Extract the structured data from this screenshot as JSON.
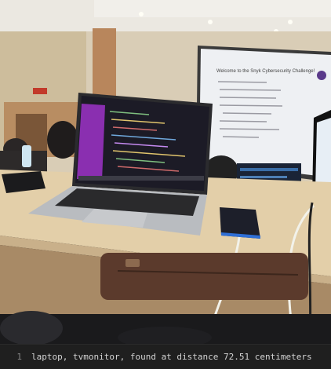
{
  "photo": {
    "subject": "laptop-on-desk-in-lecture-hall",
    "colors": {
      "ceiling": "#e9e6df",
      "wall": "#d9cdb6",
      "desk": "#e3cfa9",
      "laptop_body": "#b9bcc0",
      "screen_bg": "#1c1b26",
      "screen_panel": "#8a2fb0",
      "projection": "#eef0f3"
    },
    "slide": {
      "heading": "Welcome to the Snyk Cybersecurity Challenge!"
    }
  },
  "console": {
    "line_number": "1",
    "text": "laptop, tvmonitor, found at distance 72.51 centimeters"
  }
}
